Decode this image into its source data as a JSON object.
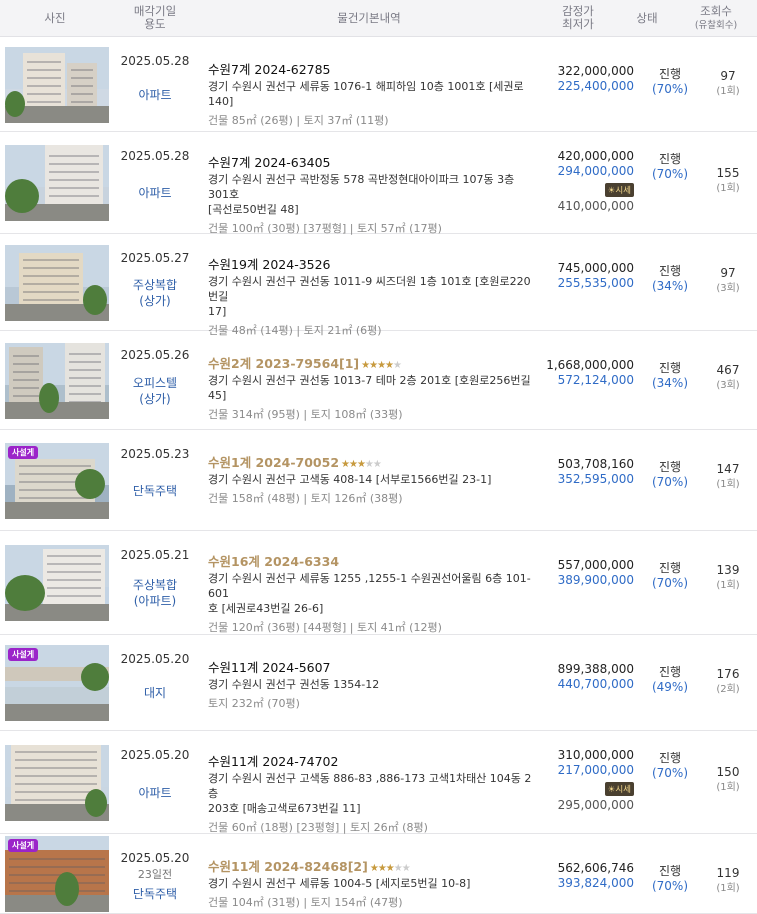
{
  "header": {
    "photo": "사진",
    "date_line1": "매각기일",
    "date_line2": "용도",
    "info": "물건기본내역",
    "price_line1": "감정가",
    "price_line2": "최저가",
    "status": "상태",
    "views_line1": "조회수",
    "views_line2": "(유찰회수)"
  },
  "rows": [
    {
      "date": "2025.05.28",
      "subdate": "",
      "usage1": "아파트",
      "usage2": "",
      "case": "수원7계 2024-62785",
      "gold": false,
      "stars": 0,
      "addr1": "경기 수원시 권선구 세류동 1076-1 해피하임 10층 1001호 [세권로 140]",
      "addr2": "",
      "area": "건물 85㎡ (26평)  |  토지 37㎡ (11평)",
      "appraisal": "322,000,000",
      "minbid": "225,400,000",
      "market_label": "",
      "market": "",
      "status": "진행",
      "pct": "(70%)",
      "views": "97",
      "fails": "(1회)",
      "badge": ""
    },
    {
      "date": "2025.05.28",
      "subdate": "",
      "usage1": "아파트",
      "usage2": "",
      "case": "수원7계 2024-63405",
      "gold": false,
      "stars": 0,
      "addr1": "경기 수원시 권선구 곡반정동 578 곡반정현대아이파크 107동 3층 301호",
      "addr2": "[곡선로50번길 48]",
      "area": "건물 100㎡ (30평) [37평형]  |  토지 57㎡ (17평)",
      "appraisal": "420,000,000",
      "minbid": "294,000,000",
      "market_label": "시세",
      "market": "410,000,000",
      "status": "진행",
      "pct": "(70%)",
      "views": "155",
      "fails": "(1회)",
      "badge": ""
    },
    {
      "date": "2025.05.27",
      "subdate": "",
      "usage1": "주상복합",
      "usage2": "(상가)",
      "case": "수원19계 2024-3526",
      "gold": false,
      "stars": 0,
      "addr1": "경기 수원시 권선구 권선동 1011-9 씨즈더원 1층 101호 [호원로220번길",
      "addr2": "17]",
      "area": "건물 48㎡ (14평)  |  토지 21㎡ (6평)",
      "appraisal": "745,000,000",
      "minbid": "255,535,000",
      "market_label": "",
      "market": "",
      "status": "진행",
      "pct": "(34%)",
      "views": "97",
      "fails": "(3회)",
      "badge": ""
    },
    {
      "date": "2025.05.26",
      "subdate": "",
      "usage1": "오피스텔",
      "usage2": "(상가)",
      "case": "수원2계 2023-79564[1]",
      "gold": true,
      "stars": 4,
      "addr1": "경기 수원시 권선구 권선동 1013-7 테마 2층 201호 [호원로256번길 45]",
      "addr2": "",
      "area": "건물 314㎡ (95평)  |  토지 108㎡ (33평)",
      "appraisal": "1,668,000,000",
      "minbid": "572,124,000",
      "market_label": "",
      "market": "",
      "status": "진행",
      "pct": "(34%)",
      "views": "467",
      "fails": "(3회)",
      "badge": ""
    },
    {
      "date": "2025.05.23",
      "subdate": "",
      "usage1": "단독주택",
      "usage2": "",
      "case": "수원1계 2024-70052",
      "gold": true,
      "stars": 3,
      "addr1": "경기 수원시 권선구 고색동 408-14 [서부로1566번길 23-1]",
      "addr2": "",
      "area": "건물 158㎡ (48평)  |  토지 126㎡ (38평)",
      "appraisal": "503,708,160",
      "minbid": "352,595,000",
      "market_label": "",
      "market": "",
      "status": "진행",
      "pct": "(70%)",
      "views": "147",
      "fails": "(1회)",
      "badge": "사설게"
    },
    {
      "date": "2025.05.21",
      "subdate": "",
      "usage1": "주상복합",
      "usage2": "(아파트)",
      "case": "수원16계 2024-6334",
      "gold": true,
      "stars": 0,
      "addr1": "경기 수원시 권선구 세류동 1255 ,1255-1 수원권선어울림 6층 101-601",
      "addr2": "호 [세권로43번길 26-6]",
      "area": "건물 120㎡ (36평) [44평형]  |  토지 41㎡ (12평)",
      "appraisal": "557,000,000",
      "minbid": "389,900,000",
      "market_label": "",
      "market": "",
      "status": "진행",
      "pct": "(70%)",
      "views": "139",
      "fails": "(1회)",
      "badge": ""
    },
    {
      "date": "2025.05.20",
      "subdate": "",
      "usage1": "대지",
      "usage2": "",
      "case": "수원11계 2024-5607",
      "gold": false,
      "stars": 0,
      "addr1": "경기 수원시 권선구 권선동 1354-12",
      "addr2": "",
      "area": "토지 232㎡ (70평)",
      "appraisal": "899,388,000",
      "minbid": "440,700,000",
      "market_label": "",
      "market": "",
      "status": "진행",
      "pct": "(49%)",
      "views": "176",
      "fails": "(2회)",
      "badge": "사설게"
    },
    {
      "date": "2025.05.20",
      "subdate": "",
      "usage1": "아파트",
      "usage2": "",
      "case": "수원11계 2024-74702",
      "gold": false,
      "stars": 0,
      "addr1": "경기 수원시 권선구 고색동 886-83 ,886-173 고색1차태산 104동 2층",
      "addr2": "203호 [매송고색로673번길 11]",
      "area": "건물 60㎡ (18평) [23평형]  |  토지 26㎡ (8평)",
      "appraisal": "310,000,000",
      "minbid": "217,000,000",
      "market_label": "시세",
      "market": "295,000,000",
      "status": "진행",
      "pct": "(70%)",
      "views": "150",
      "fails": "(1회)",
      "badge": ""
    },
    {
      "date": "2025.05.20",
      "subdate": "23일전",
      "usage1": "단독주택",
      "usage2": "",
      "case": "수원11계 2024-82468[2]",
      "gold": true,
      "stars": 3,
      "addr1": "경기 수원시 권선구 세류동 1004-5 [세지로5번길 10-8]",
      "addr2": "",
      "area": "건물 104㎡ (31평)  |  토지 154㎡ (47평)",
      "appraisal": "562,606,746",
      "minbid": "393,824,000",
      "market_label": "",
      "market": "",
      "status": "진행",
      "pct": "(70%)",
      "views": "119",
      "fails": "(1회)",
      "badge": "사설게"
    }
  ]
}
